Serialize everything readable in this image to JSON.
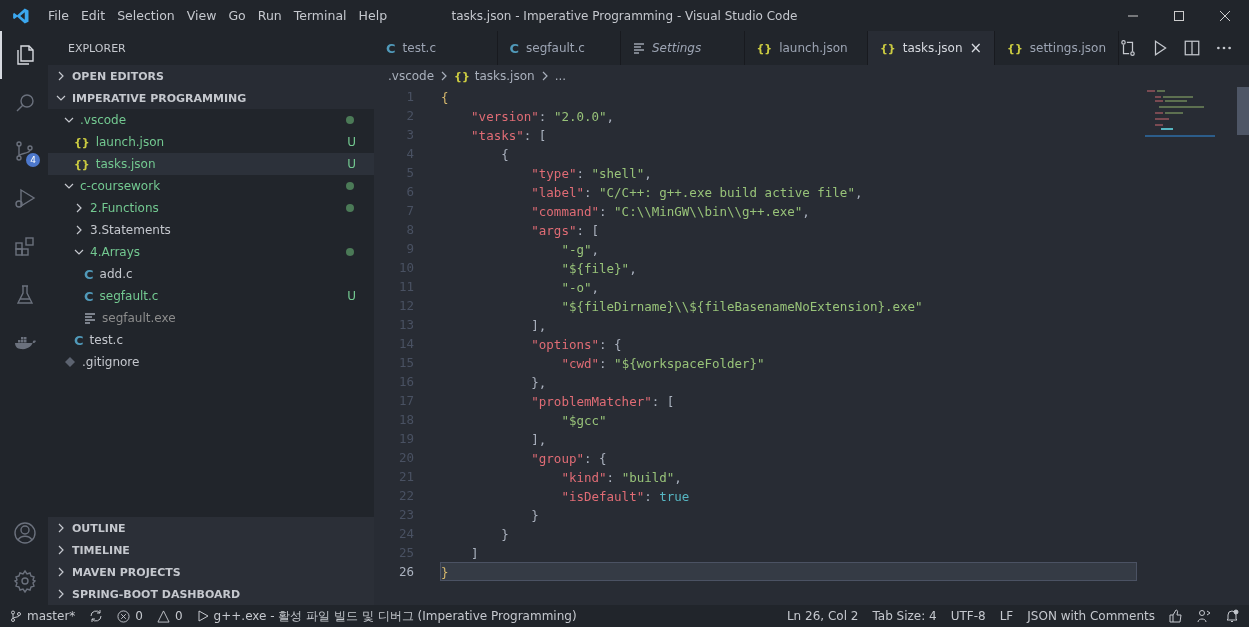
{
  "window": {
    "title": "tasks.json - Imperative Programming - Visual Studio Code"
  },
  "menu": [
    "File",
    "Edit",
    "Selection",
    "View",
    "Go",
    "Run",
    "Terminal",
    "Help"
  ],
  "activity_bar": [
    {
      "kind": "files",
      "selected": true
    },
    {
      "kind": "search",
      "selected": false
    },
    {
      "kind": "branch",
      "selected": false,
      "badge": "4"
    },
    {
      "kind": "debug",
      "selected": false
    },
    {
      "kind": "extensions",
      "selected": false
    },
    {
      "kind": "flask",
      "selected": false
    },
    {
      "kind": "docker",
      "selected": false
    }
  ],
  "activity_bottom": [
    {
      "kind": "account"
    },
    {
      "kind": "gear"
    }
  ],
  "sidebar": {
    "title": "EXPLORER",
    "sections_top": [
      {
        "label": "OPEN EDITORS",
        "expanded": false
      },
      {
        "label": "IMPERATIVE PROGRAMMING",
        "expanded": true
      }
    ],
    "tree": [
      {
        "name": ".vscode",
        "kind": "folder",
        "expanded": true,
        "color": "#73c991",
        "modified": true,
        "selected": false,
        "children": [
          {
            "name": "launch.json",
            "kind": "json",
            "glyph": "{}",
            "color": "#73c991",
            "badge": "U",
            "selected": false
          },
          {
            "name": "tasks.json",
            "kind": "json",
            "glyph": "{}",
            "color": "#73c991",
            "badge": "U",
            "selected": true
          }
        ]
      },
      {
        "name": "c-coursework",
        "kind": "folder",
        "expanded": true,
        "color": "#73c991",
        "modified": true,
        "selected": false,
        "children": [
          {
            "name": "2.Functions",
            "kind": "folder",
            "expanded": false,
            "color": "#73c991",
            "modified": true,
            "selected": false
          },
          {
            "name": "3.Statements",
            "kind": "folder",
            "expanded": false,
            "color": "#c5c8ce",
            "modified": false,
            "selected": false
          },
          {
            "name": "4.Arrays",
            "kind": "folder",
            "expanded": true,
            "color": "#73c991",
            "modified": true,
            "selected": false,
            "children": [
              {
                "name": "add.c",
                "kind": "c",
                "glyph": "C",
                "color": "#c5c8ce",
                "selected": false
              },
              {
                "name": "segfault.c",
                "kind": "c",
                "glyph": "C",
                "color": "#73c991",
                "badge": "U",
                "selected": false
              },
              {
                "name": "segfault.exe",
                "kind": "exe",
                "color": "#8c8c8c",
                "selected": false
              }
            ]
          },
          {
            "name": "test.c",
            "kind": "c",
            "glyph": "C",
            "color": "#c5c8ce",
            "selected": false
          }
        ]
      },
      {
        "name": ".gitignore",
        "kind": "git",
        "color": "#c5c8ce",
        "selected": false
      }
    ],
    "sections_bottom": [
      {
        "label": "OUTLINE",
        "expanded": false
      },
      {
        "label": "TIMELINE",
        "expanded": false
      },
      {
        "label": "MAVEN PROJECTS",
        "expanded": false
      },
      {
        "label": "SPRING-BOOT DASHBOARD",
        "expanded": false
      }
    ]
  },
  "tabs": [
    {
      "label": "test.c",
      "kind": "c",
      "glyph": "C",
      "selected": false,
      "preview": false
    },
    {
      "label": "segfault.c",
      "kind": "c",
      "glyph": "C",
      "selected": false,
      "preview": false
    },
    {
      "label": "Settings",
      "kind": "settings",
      "selected": false,
      "preview": true
    },
    {
      "label": "launch.json",
      "kind": "json",
      "glyph": "{}",
      "selected": false,
      "preview": false
    },
    {
      "label": "tasks.json",
      "kind": "json",
      "glyph": "{}",
      "selected": true,
      "preview": false,
      "close": "×"
    },
    {
      "label": "settings.json",
      "kind": "json",
      "glyph": "{}",
      "selected": false,
      "preview": false
    }
  ],
  "breadcrumb": [
    {
      "label": ".vscode"
    },
    {
      "label": "tasks.json",
      "glyph": "{}"
    },
    {
      "label": "..."
    }
  ],
  "code": [
    {
      "n": "1",
      "current": false,
      "tokens": [
        {
          "t": "{",
          "kind": "bracket"
        }
      ]
    },
    {
      "n": "2",
      "current": false,
      "tokens": [
        {
          "t": "\"version\"",
          "kind": "key"
        },
        {
          "t": ": ",
          "kind": "p"
        },
        {
          "t": "\"2.0.0\"",
          "kind": "str"
        },
        {
          "t": ",",
          "kind": "p"
        }
      ]
    },
    {
      "n": "3",
      "current": false,
      "tokens": [
        {
          "t": "\"tasks\"",
          "kind": "key"
        },
        {
          "t": ": [",
          "kind": "p"
        }
      ]
    },
    {
      "n": "4",
      "current": false,
      "tokens": [
        {
          "t": "{",
          "kind": "p"
        }
      ]
    },
    {
      "n": "5",
      "current": false,
      "tokens": [
        {
          "t": "\"type\"",
          "kind": "key"
        },
        {
          "t": ": ",
          "kind": "p"
        },
        {
          "t": "\"shell\"",
          "kind": "str"
        },
        {
          "t": ",",
          "kind": "p"
        }
      ]
    },
    {
      "n": "6",
      "current": false,
      "tokens": [
        {
          "t": "\"label\"",
          "kind": "key"
        },
        {
          "t": ": ",
          "kind": "p"
        },
        {
          "t": "\"C/C++: g++.exe build active file\"",
          "kind": "str"
        },
        {
          "t": ",",
          "kind": "p"
        }
      ]
    },
    {
      "n": "7",
      "current": false,
      "tokens": [
        {
          "t": "\"command\"",
          "kind": "key"
        },
        {
          "t": ": ",
          "kind": "p"
        },
        {
          "t": "\"C:\\\\MinGW\\\\bin\\\\g++.exe\"",
          "kind": "str"
        },
        {
          "t": ",",
          "kind": "p"
        }
      ]
    },
    {
      "n": "8",
      "current": false,
      "tokens": [
        {
          "t": "\"args\"",
          "kind": "key"
        },
        {
          "t": ": [",
          "kind": "p"
        }
      ]
    },
    {
      "n": "9",
      "current": false,
      "tokens": [
        {
          "t": "\"-g\"",
          "kind": "str"
        },
        {
          "t": ",",
          "kind": "p"
        }
      ]
    },
    {
      "n": "10",
      "current": false,
      "tokens": [
        {
          "t": "\"${file}\"",
          "kind": "str"
        },
        {
          "t": ",",
          "kind": "p"
        }
      ]
    },
    {
      "n": "11",
      "current": false,
      "tokens": [
        {
          "t": "\"-o\"",
          "kind": "str"
        },
        {
          "t": ",",
          "kind": "p"
        }
      ]
    },
    {
      "n": "12",
      "current": false,
      "tokens": [
        {
          "t": "\"${fileDirname}\\\\${fileBasenameNoExtension}.exe\"",
          "kind": "str"
        }
      ]
    },
    {
      "n": "13",
      "current": false,
      "tokens": [
        {
          "t": "],",
          "kind": "p"
        }
      ]
    },
    {
      "n": "14",
      "current": false,
      "tokens": [
        {
          "t": "\"options\"",
          "kind": "key"
        },
        {
          "t": ": {",
          "kind": "p"
        }
      ]
    },
    {
      "n": "15",
      "current": false,
      "tokens": [
        {
          "t": "\"cwd\"",
          "kind": "key"
        },
        {
          "t": ": ",
          "kind": "p"
        },
        {
          "t": "\"${workspaceFolder}\"",
          "kind": "str"
        }
      ]
    },
    {
      "n": "16",
      "current": false,
      "tokens": [
        {
          "t": "},",
          "kind": "p"
        }
      ]
    },
    {
      "n": "17",
      "current": false,
      "tokens": [
        {
          "t": "\"problemMatcher\"",
          "kind": "key"
        },
        {
          "t": ": [",
          "kind": "p"
        }
      ]
    },
    {
      "n": "18",
      "current": false,
      "tokens": [
        {
          "t": "\"$gcc\"",
          "kind": "str"
        }
      ]
    },
    {
      "n": "19",
      "current": false,
      "tokens": [
        {
          "t": "],",
          "kind": "p"
        }
      ]
    },
    {
      "n": "20",
      "current": false,
      "tokens": [
        {
          "t": "\"group\"",
          "kind": "key"
        },
        {
          "t": ": {",
          "kind": "p"
        }
      ]
    },
    {
      "n": "21",
      "current": false,
      "tokens": [
        {
          "t": "\"kind\"",
          "kind": "key"
        },
        {
          "t": ": ",
          "kind": "p"
        },
        {
          "t": "\"build\"",
          "kind": "str"
        },
        {
          "t": ",",
          "kind": "p"
        }
      ]
    },
    {
      "n": "22",
      "current": false,
      "tokens": [
        {
          "t": "\"isDefault\"",
          "kind": "key"
        },
        {
          "t": ": ",
          "kind": "p"
        },
        {
          "t": "true",
          "kind": "bool"
        }
      ]
    },
    {
      "n": "23",
      "current": false,
      "tokens": [
        {
          "t": "}",
          "kind": "p"
        }
      ]
    },
    {
      "n": "24",
      "current": false,
      "tokens": [
        {
          "t": "}",
          "kind": "p"
        }
      ]
    },
    {
      "n": "25",
      "current": false,
      "tokens": [
        {
          "t": "]",
          "kind": "p"
        }
      ]
    },
    {
      "n": "26",
      "current": true,
      "tokens": [
        {
          "t": "}",
          "kind": "bracket"
        }
      ]
    }
  ],
  "status_bar": {
    "left": [
      {
        "kind": "branch",
        "text": "master*"
      },
      {
        "kind": "sync"
      },
      {
        "kind": "error",
        "text": "0"
      },
      {
        "kind": "warning",
        "text": "0"
      },
      {
        "kind": "play",
        "text": "g++.exe - 활성 파일 빌드 및 디버그 (Imperative Programming)"
      }
    ],
    "right": [
      {
        "kind": "text",
        "text": "Ln 26, Col 2"
      },
      {
        "kind": "text",
        "text": "Tab Size: 4"
      },
      {
        "kind": "text",
        "text": "UTF-8"
      },
      {
        "kind": "text",
        "text": "LF"
      },
      {
        "kind": "text",
        "text": "JSON with Comments"
      },
      {
        "kind": "thumb"
      },
      {
        "kind": "feedback"
      },
      {
        "kind": "bell"
      }
    ]
  }
}
